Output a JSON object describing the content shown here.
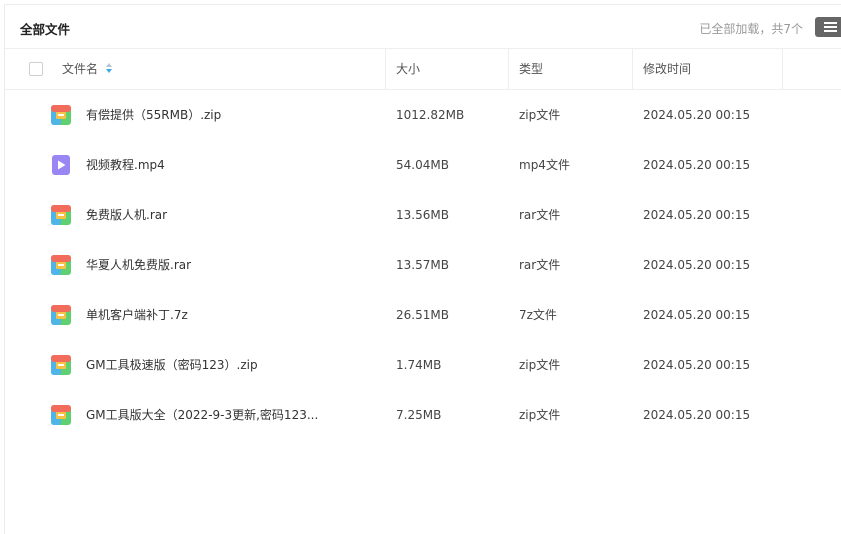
{
  "header": {
    "title": "全部文件",
    "loaded_status": "已全部加载，共7个"
  },
  "columns": {
    "name": "文件名",
    "size": "大小",
    "type": "类型",
    "modified": "修改时间"
  },
  "files": [
    {
      "name": "有偿提供（55RMB）.zip",
      "size": "1012.82MB",
      "type": "zip文件",
      "modified": "2024.05.20 00:15",
      "icon": "archive-icon"
    },
    {
      "name": "视频教程.mp4",
      "size": "54.04MB",
      "type": "mp4文件",
      "modified": "2024.05.20 00:15",
      "icon": "video-icon"
    },
    {
      "name": "免费版人机.rar",
      "size": "13.56MB",
      "type": "rar文件",
      "modified": "2024.05.20 00:15",
      "icon": "archive-icon"
    },
    {
      "name": "华夏人机免费版.rar",
      "size": "13.57MB",
      "type": "rar文件",
      "modified": "2024.05.20 00:15",
      "icon": "archive-icon"
    },
    {
      "name": "单机客户端补丁.7z",
      "size": "26.51MB",
      "type": "7z文件",
      "modified": "2024.05.20 00:15",
      "icon": "archive-icon"
    },
    {
      "name": "GM工具极速版（密码123）.zip",
      "size": "1.74MB",
      "type": "zip文件",
      "modified": "2024.05.20 00:15",
      "icon": "archive-icon"
    },
    {
      "name": "GM工具版大全（2022-9-3更新,密码123...",
      "size": "7.25MB",
      "type": "zip文件",
      "modified": "2024.05.20 00:15",
      "icon": "archive-icon"
    }
  ],
  "colors": {
    "archive_top": "#f26b5b",
    "archive_mid": "#f6c243",
    "archive_left": "#4fb5e8",
    "archive_right": "#5fcf72",
    "video": "#9a86f2"
  }
}
